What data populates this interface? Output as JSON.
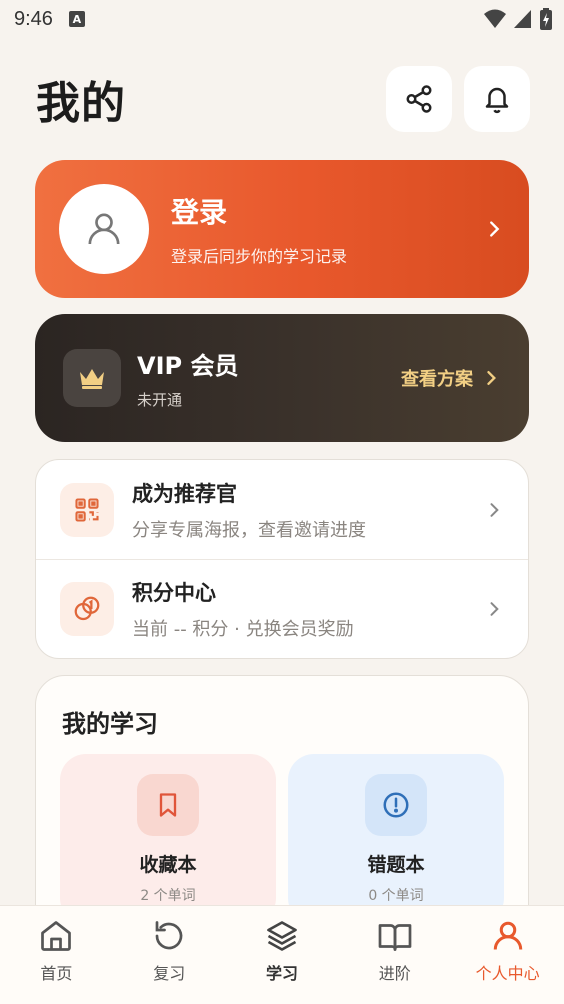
{
  "status": {
    "time": "9:46",
    "notification_icon": "A"
  },
  "header": {
    "title": "我的"
  },
  "login": {
    "title": "登录",
    "subtitle": "登录后同步你的学习记录"
  },
  "vip": {
    "title": "VIP 会员",
    "status": "未开通",
    "link": "查看方案"
  },
  "menu": {
    "items": [
      {
        "title": "成为推荐官",
        "subtitle": "分享专属海报，查看邀请进度",
        "icon": "qr-code-icon"
      },
      {
        "title": "积分中心",
        "subtitle": "当前 -- 积分 · 兑换会员奖励",
        "icon": "coins-icon"
      }
    ]
  },
  "study": {
    "title": "我的学习",
    "tiles": [
      {
        "label": "收藏本",
        "count": "2 个单词"
      },
      {
        "label": "错题本",
        "count": "0 个单词"
      }
    ]
  },
  "nav": {
    "items": [
      {
        "label": "首页",
        "icon": "home-icon"
      },
      {
        "label": "复习",
        "icon": "refresh-icon"
      },
      {
        "label": "学习",
        "icon": "layers-icon"
      },
      {
        "label": "进阶",
        "icon": "book-icon"
      },
      {
        "label": "个人中心",
        "icon": "user-icon"
      }
    ],
    "active_index": 4
  },
  "colors": {
    "accent": "#e8592d",
    "vip_gold": "#f2cf84",
    "background": "#f7f3ee"
  }
}
